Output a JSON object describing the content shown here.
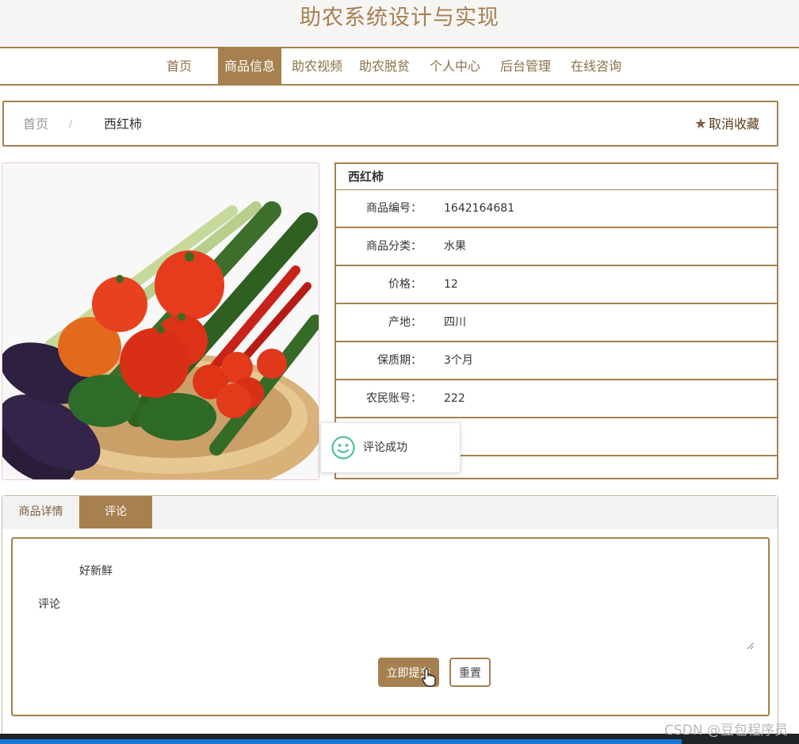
{
  "site": {
    "title": "助农系统设计与实现"
  },
  "nav": {
    "items": [
      {
        "label": "首页"
      },
      {
        "label": "商品信息"
      },
      {
        "label": "助农视频"
      },
      {
        "label": "助农脱贫"
      },
      {
        "label": "个人中心"
      },
      {
        "label": "后台管理"
      },
      {
        "label": "在线咨询"
      }
    ],
    "active_index": 1
  },
  "breadcrumb": {
    "home": "首页",
    "separator": "/",
    "current": "西红柿"
  },
  "favorite": {
    "label": "取消收藏",
    "icon": "star-icon"
  },
  "product": {
    "image_icon": "vegetable-basket-photo",
    "name": "西红柿",
    "fields": [
      {
        "label": "商品编号：",
        "value": "1642164681"
      },
      {
        "label": "商品分类：",
        "value": "水果"
      },
      {
        "label": "价格：",
        "value": "12"
      },
      {
        "label": "产地：",
        "value": "四川"
      },
      {
        "label": "保质期：",
        "value": "3个月"
      },
      {
        "label": "农民账号：",
        "value": "222"
      }
    ]
  },
  "toast": {
    "message": "评论成功",
    "icon": "smile-icon"
  },
  "tabs": {
    "items": [
      {
        "label": "商品详情"
      },
      {
        "label": "评论"
      }
    ],
    "active_index": 1
  },
  "comment": {
    "label": "评论",
    "value": "好新鲜",
    "submit_label": "立即提交",
    "reset_label": "重置"
  },
  "watermark": "CSDN @豆包程序员",
  "colors": {
    "accent": "#a6804f",
    "header_bg": "#f5f5f4",
    "toast_icon": "#3fbf8f"
  }
}
